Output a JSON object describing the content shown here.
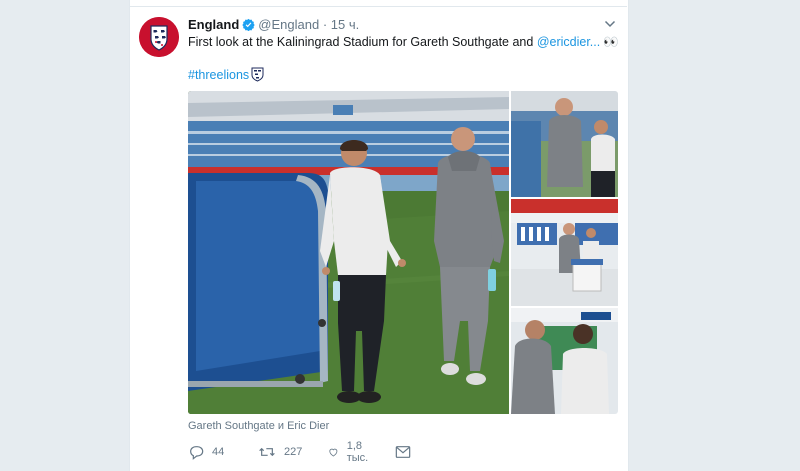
{
  "tweet": {
    "author_name": "England",
    "handle": "@England",
    "separator": "·",
    "time": "15 ч.",
    "text_prefix": "First look at the Kaliningrad Stadium for Gareth Southgate and ",
    "mention": "@ericdier...",
    "emoji": "👀",
    "hashtag": "#threelions",
    "media_caption": "Gareth Southgate и Eric Dier"
  },
  "actions": {
    "replies": "44",
    "retweets": "227",
    "likes": "1,8 тыс."
  },
  "media_overlay": {
    "stadium_sign": "2018 FIFA WORLD CUP RUSSIA"
  },
  "colors": {
    "link": "#1b95e0",
    "verified": "#1da1f2",
    "muted": "#657786",
    "brand": "#c8102e"
  },
  "icons": [
    "england-crest-icon",
    "verified-icon",
    "chevron-down-icon",
    "reply-icon",
    "retweet-icon",
    "like-icon",
    "message-icon"
  ]
}
